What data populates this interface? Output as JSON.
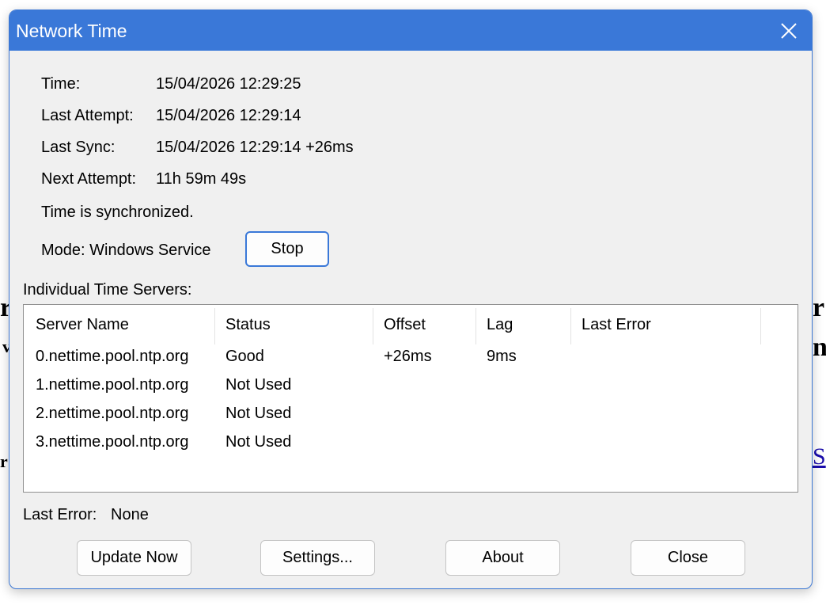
{
  "window": {
    "title": "Network Time"
  },
  "info": {
    "time_label": "Time:",
    "time_value": "15/04/2026 12:29:25",
    "last_attempt_label": "Last Attempt:",
    "last_attempt_value": "15/04/2026 12:29:14",
    "last_sync_label": "Last Sync:",
    "last_sync_value": "15/04/2026 12:29:14 +26ms",
    "next_attempt_label": "Next Attempt:",
    "next_attempt_value": "11h 59m 49s",
    "sync_status": "Time is synchronized.",
    "mode_text": "Mode: Windows Service",
    "stop_label": "Stop"
  },
  "servers": {
    "section_label": "Individual Time Servers:",
    "columns": [
      "Server Name",
      "Status",
      "Offset",
      "Lag",
      "Last Error"
    ],
    "rows": [
      {
        "name": "0.nettime.pool.ntp.org",
        "status": "Good",
        "offset": "+26ms",
        "lag": "9ms",
        "last_error": ""
      },
      {
        "name": "1.nettime.pool.ntp.org",
        "status": "Not Used",
        "offset": "",
        "lag": "",
        "last_error": ""
      },
      {
        "name": "2.nettime.pool.ntp.org",
        "status": "Not Used",
        "offset": "",
        "lag": "",
        "last_error": ""
      },
      {
        "name": "3.nettime.pool.ntp.org",
        "status": "Not Used",
        "offset": "",
        "lag": "",
        "last_error": ""
      }
    ]
  },
  "footer": {
    "last_error_label": "Last Error:",
    "last_error_value": "None",
    "buttons": {
      "update_now": "Update Now",
      "settings": "Settings...",
      "about": "About",
      "close": "Close"
    }
  },
  "background_page": {
    "frag_a": "r",
    "frag_b": "v",
    "frag_c": "r",
    "frag_d": "r",
    "frag_e": "n",
    "frag_f": "S"
  },
  "colors": {
    "titlebar": "#3a78d8",
    "dialog_bg": "#f0f0f0",
    "accent_border": "#3a78d8"
  }
}
